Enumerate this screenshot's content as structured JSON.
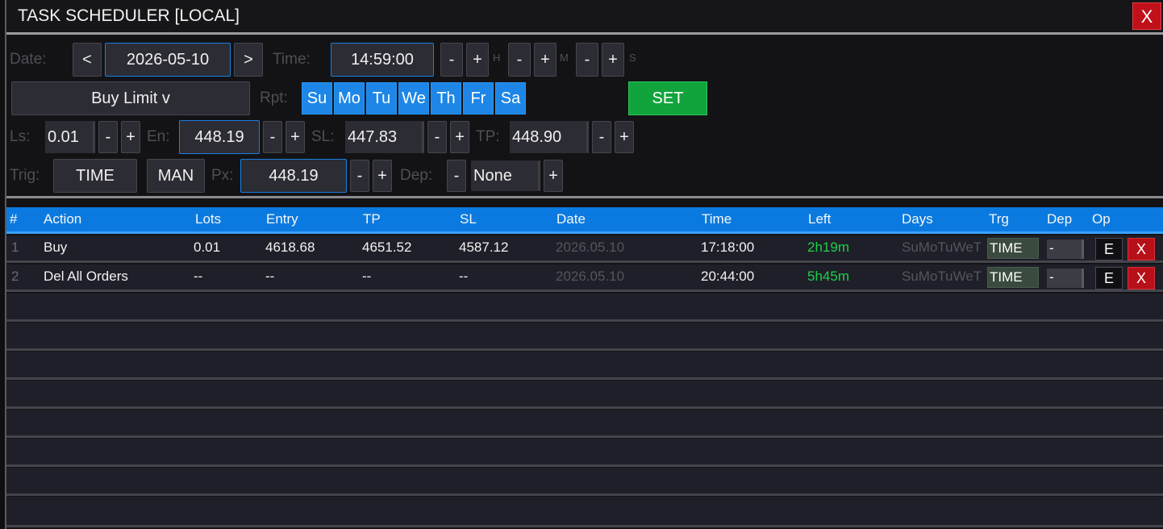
{
  "window": {
    "title": "TASK SCHEDULER [LOCAL]",
    "close_label": "X"
  },
  "controls": {
    "date_label": "Date:",
    "prev_label": "<",
    "next_label": ">",
    "date_value": "2026-05-10",
    "time_label": "Time:",
    "time_value": "14:59:00",
    "minus": "-",
    "plus": "+",
    "h_label": "H",
    "m_label": "M",
    "s_label": "S",
    "order_type": "Buy Limit v",
    "rpt_label": "Rpt:",
    "days": [
      "Su",
      "Mo",
      "Tu",
      "We",
      "Th",
      "Fr",
      "Sa"
    ],
    "set_label": "SET",
    "ls_label": "Ls:",
    "ls_value": "0.01",
    "en_label": "En:",
    "en_value": "448.19",
    "sl_label": "SL:",
    "sl_value": "447.83",
    "tp_label": "TP:",
    "tp_value": "448.90",
    "trig_label": "Trig:",
    "trig_time": "TIME",
    "trig_man": "MAN",
    "px_label": "Px:",
    "px_value": "448.19",
    "dep_label": "Dep:",
    "dep_value": "None"
  },
  "table": {
    "columns": [
      "#",
      "Action",
      "Lots",
      "Entry",
      "TP",
      "SL",
      "Date",
      "Time",
      "Left",
      "Days",
      "Trg",
      "Dep",
      "Op"
    ],
    "rows": [
      {
        "idx": "1",
        "action": "Buy",
        "lots": "0.01",
        "entry": "4618.68",
        "tp": "4651.52",
        "sl": "4587.12",
        "date": "2026.05.10",
        "time": "17:18:00",
        "left": "2h19m",
        "days": "SuMoTuWeT",
        "trg": "TIME",
        "dep": "-",
        "edit": "E",
        "del": "X"
      },
      {
        "idx": "2",
        "action": "Del All Orders",
        "lots": "--",
        "entry": "--",
        "tp": "--",
        "sl": "--",
        "date": "2026.05.10",
        "time": "20:44:00",
        "left": "5h45m",
        "days": "SuMoTuWeT",
        "trg": "TIME",
        "dep": "-",
        "edit": "E",
        "del": "X"
      }
    ]
  },
  "colors": {
    "accent": "#0b7ae0",
    "day_toggle": "#1d86e6",
    "set": "#12a43c",
    "close": "#c0101a",
    "left_green": "#1ed048"
  }
}
